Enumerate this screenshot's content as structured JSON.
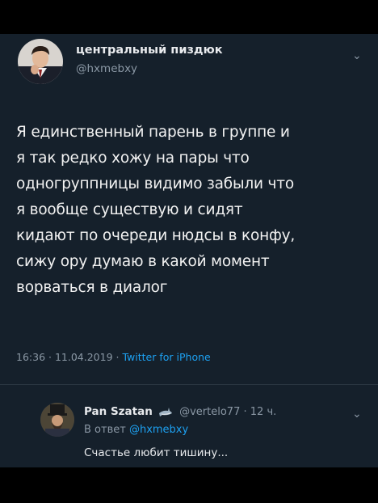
{
  "tweet": {
    "author_name": "центральный пиздюк",
    "author_handle": "@hxmebxy",
    "lines": [
      "Я единственный парень в группе и",
      "я так редко хожу на пары что",
      "одногруппницы видимо забыли что",
      "я вообще существую и сидят",
      "кидают по очереди нюдсы в конфу,",
      "сижу ору думаю в какой момент",
      "ворваться в диалог"
    ],
    "time": "16:36",
    "date": "11.04.2019",
    "source": "Twitter for iPhone",
    "menu_icon": "chevron-down-icon"
  },
  "reply": {
    "author_name": "Pan Szatan",
    "author_handle": "@vertelo77",
    "age": "12 ч.",
    "replying_to_prefix": "В ответ",
    "replying_to_handle": "@hxmebxy",
    "text": "Счастье любит тишину...",
    "badge_icon": "shark-emoji-icon",
    "menu_icon": "chevron-down-icon"
  },
  "colors": {
    "background": "#15202b",
    "outer": "#000000",
    "text": "#f2f2f2",
    "muted": "#8b98a5",
    "accent": "#1da1f2"
  }
}
